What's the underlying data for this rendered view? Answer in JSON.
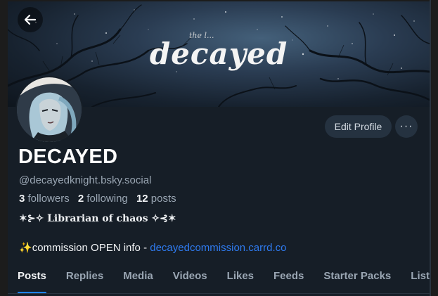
{
  "banner": {
    "title": "decayed",
    "kicker": "the l..."
  },
  "profile": {
    "display_name": "DECAYED",
    "handle": "@decayedknight.bsky.social",
    "followers_count": "3",
    "followers_label": "followers",
    "following_count": "2",
    "following_label": "following",
    "posts_count": "12",
    "posts_label": "posts",
    "bio_line1": "✶⊱✧ Librarian of chaos ✧⊰✶",
    "bio_line2_prefix": "✨",
    "bio_line2_text": "commission OPEN info - ",
    "bio_link": "decayedcommission.carrd.co"
  },
  "actions": {
    "edit_profile": "Edit Profile",
    "more": "···"
  },
  "tabs": [
    "Posts",
    "Replies",
    "Media",
    "Videos",
    "Likes",
    "Feeds",
    "Starter Packs",
    "Lists"
  ],
  "colors": {
    "accent": "#1e83ff",
    "link": "#2f7bf0",
    "background": "#161e27"
  }
}
